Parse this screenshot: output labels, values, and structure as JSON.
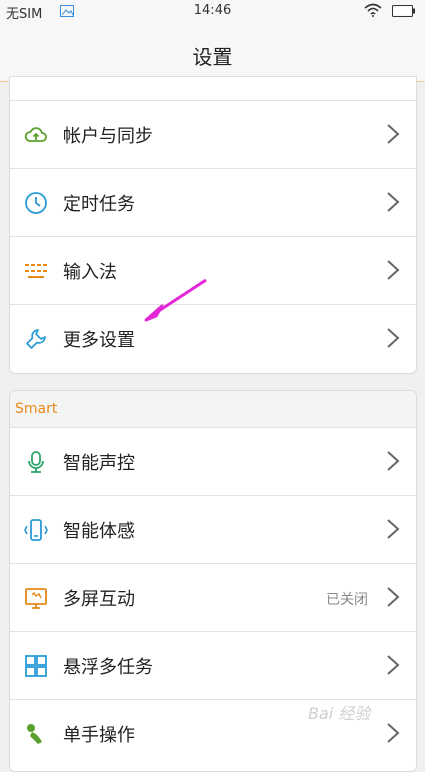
{
  "status_bar": {
    "sim": "无SIM",
    "time": "14:46"
  },
  "header": {
    "title": "设置"
  },
  "group1": {
    "items": [
      {
        "label": "帐户与同步",
        "icon": "cloud-sync-icon"
      },
      {
        "label": "定时任务",
        "icon": "clock-icon"
      },
      {
        "label": "输入法",
        "icon": "keyboard-icon"
      },
      {
        "label": "更多设置",
        "icon": "wrench-icon"
      }
    ]
  },
  "group2": {
    "header": "Smart",
    "items": [
      {
        "label": "智能声控",
        "icon": "microphone-icon"
      },
      {
        "label": "智能体感",
        "icon": "phone-motion-icon"
      },
      {
        "label": "多屏互动",
        "icon": "multi-screen-icon",
        "status": "已关闭"
      },
      {
        "label": "悬浮多任务",
        "icon": "floating-task-icon"
      },
      {
        "label": "单手操作",
        "icon": "one-hand-icon"
      }
    ]
  },
  "colors": {
    "accent": "#e8891a",
    "green": "#5aa02c",
    "blue": "#2a9bd6",
    "arrow": "#e426d9"
  },
  "watermark": "Bai 经验"
}
